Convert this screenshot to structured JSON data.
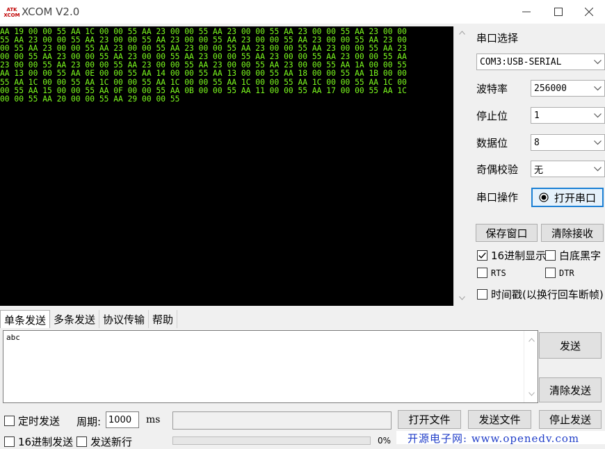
{
  "window": {
    "logo_text": "ATK XCOM",
    "title": "XCOM V2.0",
    "minimize_glyph": "—",
    "maximize_glyph": "☐",
    "close_glyph": "✕"
  },
  "receive": {
    "lines": [
      "AA 19 00 00 55 AA 1C 00 00 55 AA 23 00 00 55 AA 23 00 00 55 AA 23 00 00 55 AA 23 00 00",
      "55 AA 23 00 00 55 AA 23 00 00 55 AA 23 00 00 55 AA 23 00 00 55 AA 23 00 00 55 AA 23 00",
      "00 55 AA 23 00 00 55 AA 23 00 00 55 AA 23 00 00 55 AA 23 00 00 55 AA 23 00 00 55 AA 23",
      "00 00 55 AA 23 00 00 55 AA 23 00 00 55 AA 23 00 00 55 AA 23 00 00 55 AA 23 00 00 55 AA",
      "23 00 00 55 AA 23 00 00 55 AA 23 00 00 55 AA 23 00 00 55 AA 23 00 00 55 AA 1A 00 00 55",
      "AA 13 00 00 55 AA 0E 00 00 55 AA 14 00 00 55 AA 13 00 00 55 AA 18 00 00 55 AA 1B 00 00",
      "55 AA 1C 00 00 55 AA 1C 00 00 55 AA 1C 00 00 55 AA 1C 00 00 55 AA 1C 00 00 55 AA 1C 00",
      "00 55 AA 15 00 00 55 AA 0F 00 00 55 AA 0B 00 00 55 AA 11 00 00 55 AA 17 00 00 55 AA 1C",
      "00 00 55 AA 20 00 00 55 AA 29 00 00 55"
    ]
  },
  "serial": {
    "port_select_label": "串口选择",
    "port_value": "COM3:USB-SERIAL",
    "baud_label": "波特率",
    "baud_value": "256000",
    "stopbits_label": "停止位",
    "stopbits_value": "1",
    "databits_label": "数据位",
    "databits_value": "8",
    "parity_label": "奇偶校验",
    "parity_value": "无",
    "operation_label": "串口操作",
    "open_port_button": "打开串口",
    "save_window_button": "保存窗口",
    "clear_receive_button": "清除接收",
    "hex_display_label": "16进制显示",
    "white_bg_label": "白底黑字",
    "rts_label": "RTS",
    "dtr_label": "DTR",
    "timestamp_label": "时间戳(以换行回车断帧)"
  },
  "tabs": [
    "单条发送",
    "多条发送",
    "协议传输",
    "帮助"
  ],
  "send": {
    "text": "abc",
    "send_button": "发送",
    "clear_send_button": "清除发送"
  },
  "bottom": {
    "timed_send_label": "定时发送",
    "period_label": "周期:",
    "period_value": "1000",
    "period_unit": "ms",
    "open_file_button": "打开文件",
    "send_file_button": "发送文件",
    "stop_send_button": "停止发送",
    "hex_send_label": "16进制发送",
    "send_newline_label": "发送新行",
    "progress_text": "0%",
    "progress_fraction": 0,
    "footer_link": "开源电子网: www.openedv.com"
  },
  "colors": {
    "terminal_bg": "#000000",
    "terminal_fg": "#7cfc1e",
    "link": "#1e3cc8"
  }
}
